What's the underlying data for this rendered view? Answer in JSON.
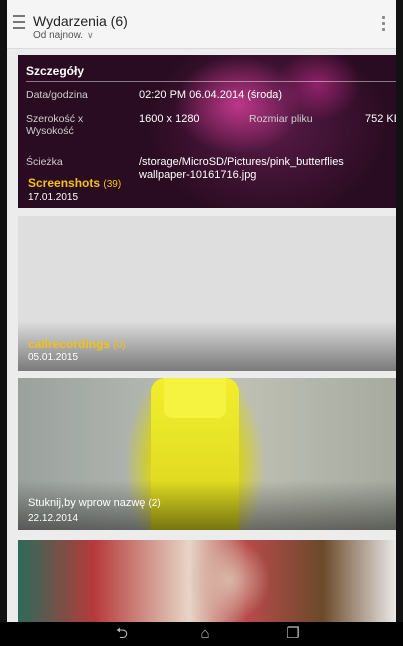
{
  "actionbar": {
    "title": "Wydarzenia (6)",
    "subtitle": "Od najnow.",
    "chevron": "∨",
    "menu_icon": "hamburger-icon",
    "overflow_icon": "overflow-menu-icon"
  },
  "details": {
    "header": "Szczegóły",
    "date_label": "Data/godzina",
    "date_value": "02:20 PM 06.04.2014 (środa)",
    "size_label_1": "Szerokość x",
    "size_label_2": "Wysokość",
    "size_value": "1600 x 1280",
    "filesize_label": "Rozmiar pliku",
    "filesize_value": "752 KB",
    "path_label": "Ścieżka",
    "path_value_1": "/storage/MicroSD/Pictures/pink_butterflies",
    "path_value_2": "wallpaper-10161716.jpg"
  },
  "albums": [
    {
      "name": "Screenshots",
      "count": "(39)",
      "date": "17.01.2015"
    },
    {
      "name": "callrecordings",
      "count": "(0)",
      "date": "05.01.2015"
    },
    {
      "name": "Stuknij,by wprow nazwę",
      "count": "(2)",
      "date": "22.12.2014"
    }
  ],
  "navbar": {
    "back_icon": "⮌",
    "home_icon": "⌂",
    "recents_icon": "❐"
  }
}
